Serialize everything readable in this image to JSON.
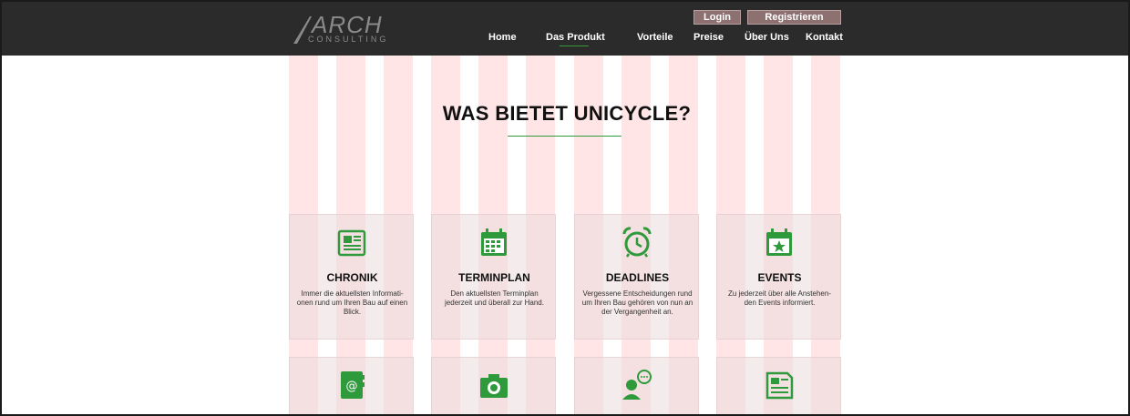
{
  "header": {
    "logo_main": "ARCH",
    "logo_sub": "CONSULTING",
    "login_label": "Login",
    "register_label": "Registrieren",
    "nav": [
      "Home",
      "Das Produkt",
      "Vorteile",
      "Preise",
      "Über Uns",
      "Kontakt"
    ],
    "active_nav": "Das Produkt"
  },
  "main": {
    "heading": "WAS BIETET UNICYCLE?"
  },
  "cards": [
    {
      "icon": "newspaper-icon",
      "title": "CHRONIK",
      "desc": "Immer die aktuellsten Informati-onen rund um Ihren Bau auf einen Blick."
    },
    {
      "icon": "calendar-icon",
      "title": "TERMINPLAN",
      "desc": "Den aktuellsten Terminplan jederzeit und überall zur Hand."
    },
    {
      "icon": "alarm-clock-icon",
      "title": "DEADLINES",
      "desc": "Vergessene Entscheidungen rund um Ihren Bau gehören von nun an der Vergangenheit an."
    },
    {
      "icon": "calendar-star-icon",
      "title": "EVENTS",
      "desc": "Zu jederzeit über alle Anstehen-den Events informiert."
    },
    {
      "icon": "address-book-icon",
      "title": "",
      "desc": ""
    },
    {
      "icon": "camera-icon",
      "title": "",
      "desc": ""
    },
    {
      "icon": "chat-user-icon",
      "title": "",
      "desc": ""
    },
    {
      "icon": "document-icon",
      "title": "",
      "desc": ""
    }
  ],
  "colors": {
    "header_bg": "#2b2b2b",
    "accent_green": "#2e9a3c",
    "auth_button": "#8d7070",
    "overlay_pink": "#ffdcdc"
  }
}
